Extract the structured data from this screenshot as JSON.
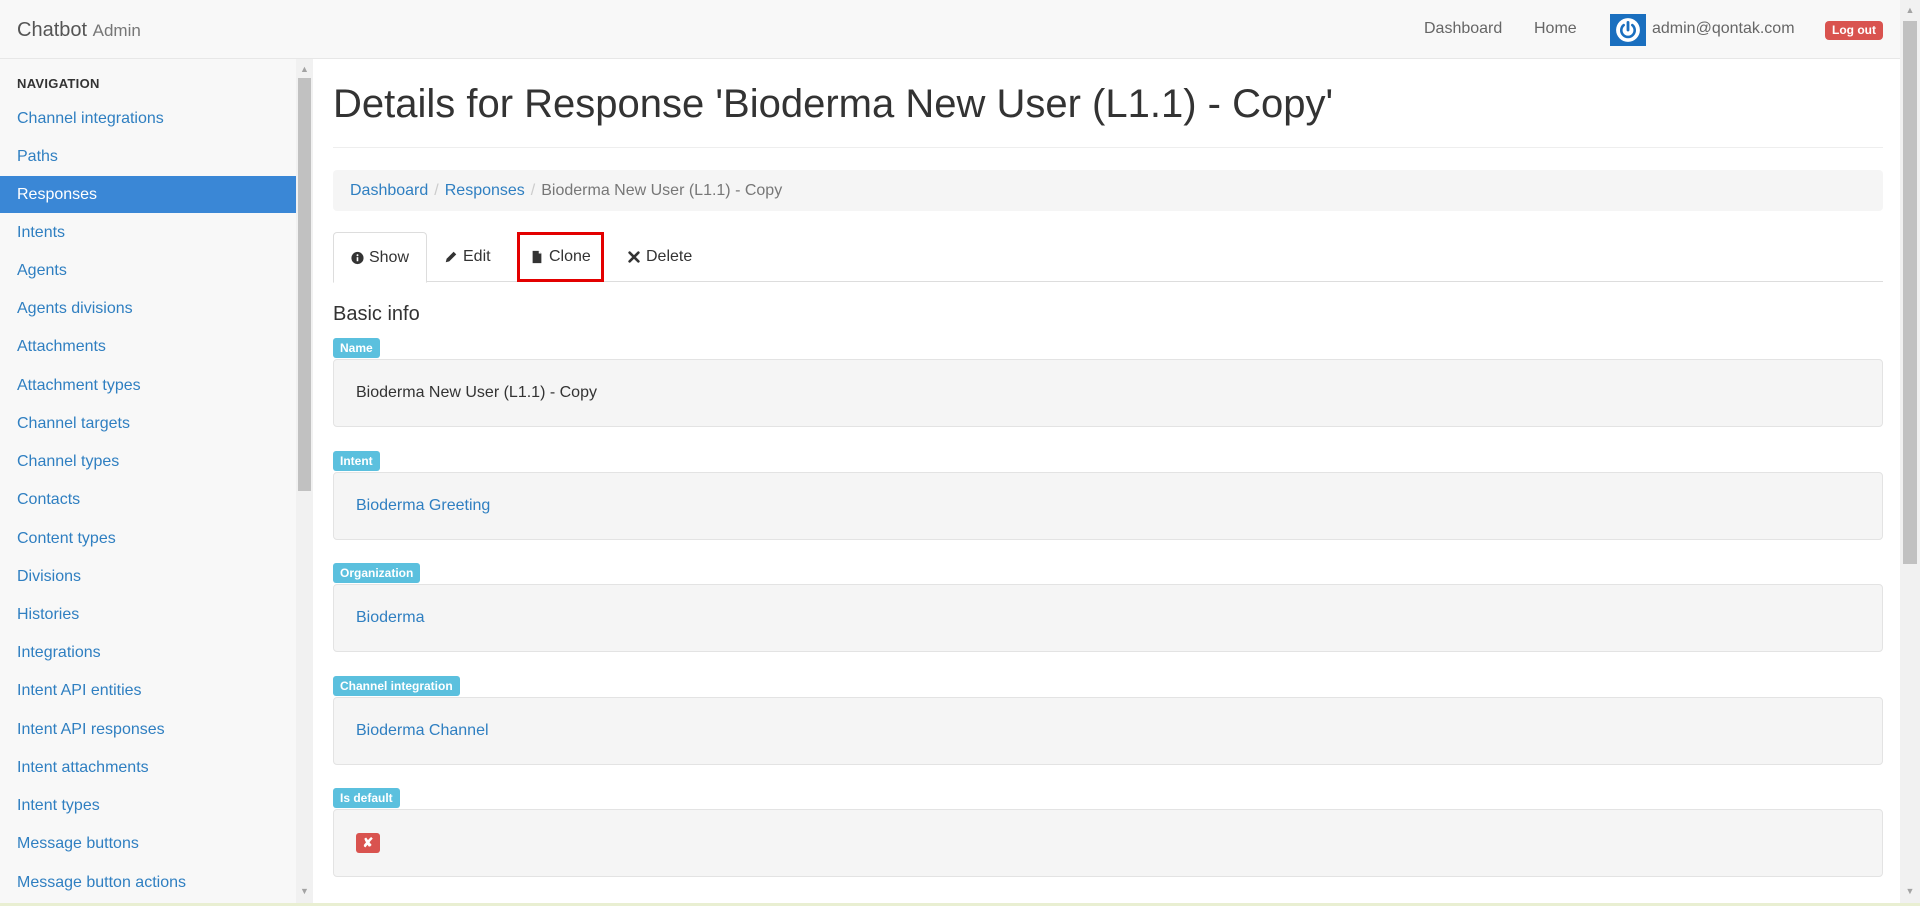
{
  "navbar": {
    "brand": "Chatbot",
    "brand_sub": "Admin",
    "links": {
      "dashboard": "Dashboard",
      "home": "Home"
    },
    "user_email": "admin@qontak.com",
    "logout_label": "Log out"
  },
  "sidebar": {
    "header": "NAVIGATION",
    "items": [
      {
        "label": "Channel integrations",
        "active": false
      },
      {
        "label": "Paths",
        "active": false
      },
      {
        "label": "Responses",
        "active": true
      },
      {
        "label": "Intents",
        "active": false
      },
      {
        "label": "Agents",
        "active": false
      },
      {
        "label": "Agents divisions",
        "active": false
      },
      {
        "label": "Attachments",
        "active": false
      },
      {
        "label": "Attachment types",
        "active": false
      },
      {
        "label": "Channel targets",
        "active": false
      },
      {
        "label": "Channel types",
        "active": false
      },
      {
        "label": "Contacts",
        "active": false
      },
      {
        "label": "Content types",
        "active": false
      },
      {
        "label": "Divisions",
        "active": false
      },
      {
        "label": "Histories",
        "active": false
      },
      {
        "label": "Integrations",
        "active": false
      },
      {
        "label": "Intent API entities",
        "active": false
      },
      {
        "label": "Intent API responses",
        "active": false
      },
      {
        "label": "Intent attachments",
        "active": false
      },
      {
        "label": "Intent types",
        "active": false
      },
      {
        "label": "Message buttons",
        "active": false
      },
      {
        "label": "Message button actions",
        "active": false
      }
    ]
  },
  "main": {
    "title": "Details for Response 'Bioderma New User (L1.1) - Copy'",
    "breadcrumb": {
      "items": [
        "Dashboard",
        "Responses"
      ],
      "active": "Bioderma New User (L1.1) - Copy"
    },
    "tabs": {
      "show": "Show",
      "edit": "Edit",
      "clone": "Clone",
      "delete": "Delete"
    },
    "section_title": "Basic info",
    "fields": {
      "name": {
        "label": "Name",
        "value": "Bioderma New User (L1.1) - Copy"
      },
      "intent": {
        "label": "Intent",
        "value": "Bioderma Greeting"
      },
      "organization": {
        "label": "Organization",
        "value": "Bioderma"
      },
      "channel_integration": {
        "label": "Channel integration",
        "value": "Bioderma Channel"
      },
      "is_default": {
        "label": "Is default",
        "value": "✘"
      }
    }
  },
  "colors": {
    "link": "#2f7fc1",
    "active_nav": "#3a87d6",
    "label_badge": "#5bc0de",
    "danger": "#d9534f",
    "highlight_box": "#e30000"
  },
  "icons": {
    "show": "info-circle-icon",
    "edit": "pencil-icon",
    "clone": "file-icon",
    "delete": "times-icon",
    "avatar": "power-icon"
  }
}
